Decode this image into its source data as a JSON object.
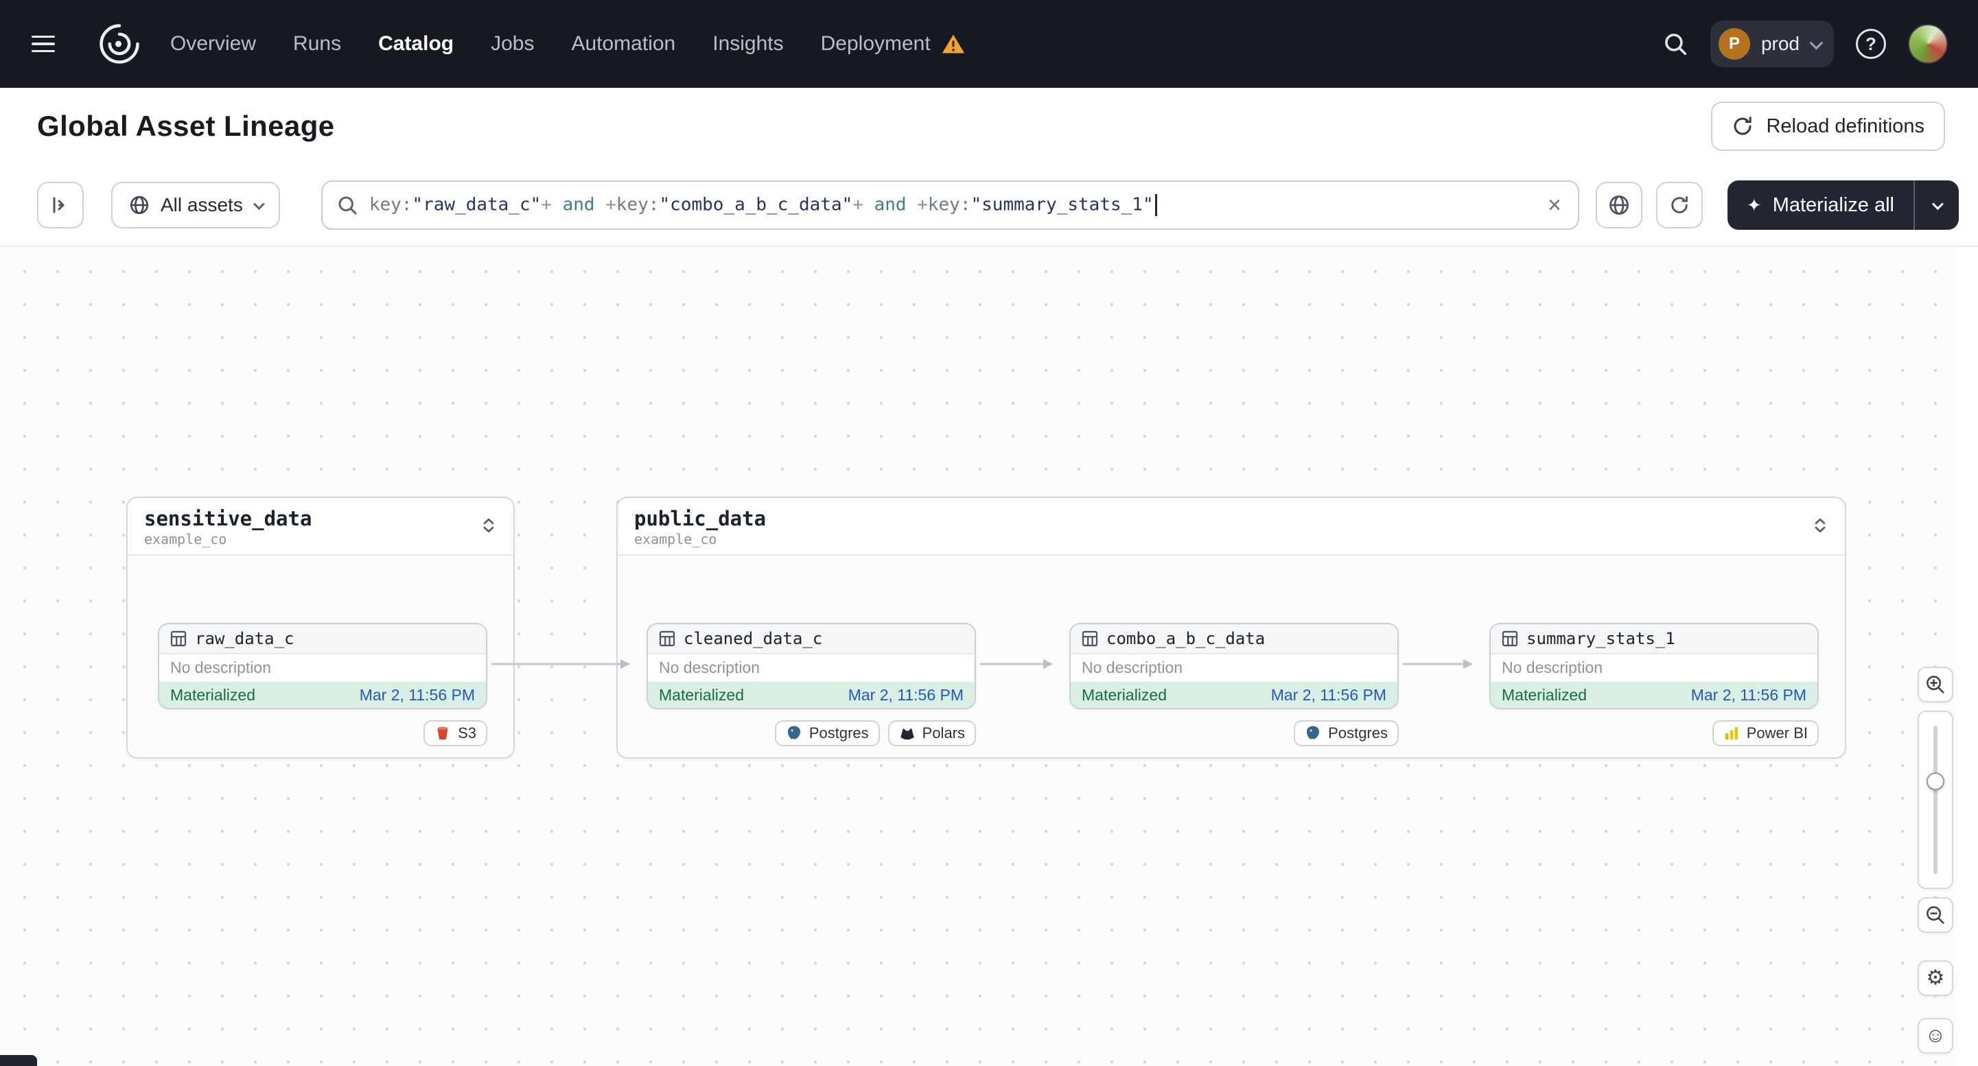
{
  "nav": {
    "items": [
      {
        "label": "Overview"
      },
      {
        "label": "Runs"
      },
      {
        "label": "Catalog"
      },
      {
        "label": "Jobs"
      },
      {
        "label": "Automation"
      },
      {
        "label": "Insights"
      },
      {
        "label": "Deployment"
      }
    ],
    "env": {
      "initial": "P",
      "label": "prod"
    }
  },
  "header": {
    "title": "Global Asset Lineage",
    "reload_label": "Reload definitions"
  },
  "toolbar": {
    "scope_label": "All assets",
    "materialize_label": "Materialize all",
    "query": {
      "segments": [
        {
          "text": "key:"
        },
        {
          "text": "\"raw_data_c\""
        },
        {
          "text": "+"
        },
        {
          "text": " and "
        },
        {
          "text": "+"
        },
        {
          "text": "key:"
        },
        {
          "text": "\"combo_a_b_c_data\""
        },
        {
          "text": "+"
        },
        {
          "text": " and "
        },
        {
          "text": "+"
        },
        {
          "text": "key:"
        },
        {
          "text": "\"summary_stats_1\""
        }
      ]
    }
  },
  "graph": {
    "groups": [
      {
        "name": "sensitive_data",
        "repo": "example_co",
        "nodes": [
          {
            "name": "raw_data_c",
            "description": "No description",
            "status": "Materialized",
            "timestamp": "Mar 2, 11:56 PM",
            "tags": [
              {
                "label": "S3"
              }
            ]
          }
        ]
      },
      {
        "name": "public_data",
        "repo": "example_co",
        "nodes": [
          {
            "name": "cleaned_data_c",
            "description": "No description",
            "status": "Materialized",
            "timestamp": "Mar 2, 11:56 PM",
            "tags": [
              {
                "label": "Postgres"
              },
              {
                "label": "Polars"
              }
            ]
          },
          {
            "name": "combo_a_b_c_data",
            "description": "No description",
            "status": "Materialized",
            "timestamp": "Mar 2, 11:56 PM",
            "tags": [
              {
                "label": "Postgres"
              }
            ]
          },
          {
            "name": "summary_stats_1",
            "description": "No description",
            "status": "Materialized",
            "timestamp": "Mar 2, 11:56 PM",
            "tags": [
              {
                "label": "Power BI"
              }
            ]
          }
        ]
      }
    ]
  },
  "icons": {
    "clear": "×",
    "materialize": "✦",
    "settings": "⚙",
    "feedback": "☺",
    "help": "?"
  },
  "colors": {
    "nav_bg": "#161920",
    "status_materialized_bg": "#d8efe1",
    "status_materialized_text": "#176e41",
    "timestamp_link": "#2257c5",
    "warning": "#f2a42c",
    "materialize_button": "#222733"
  }
}
